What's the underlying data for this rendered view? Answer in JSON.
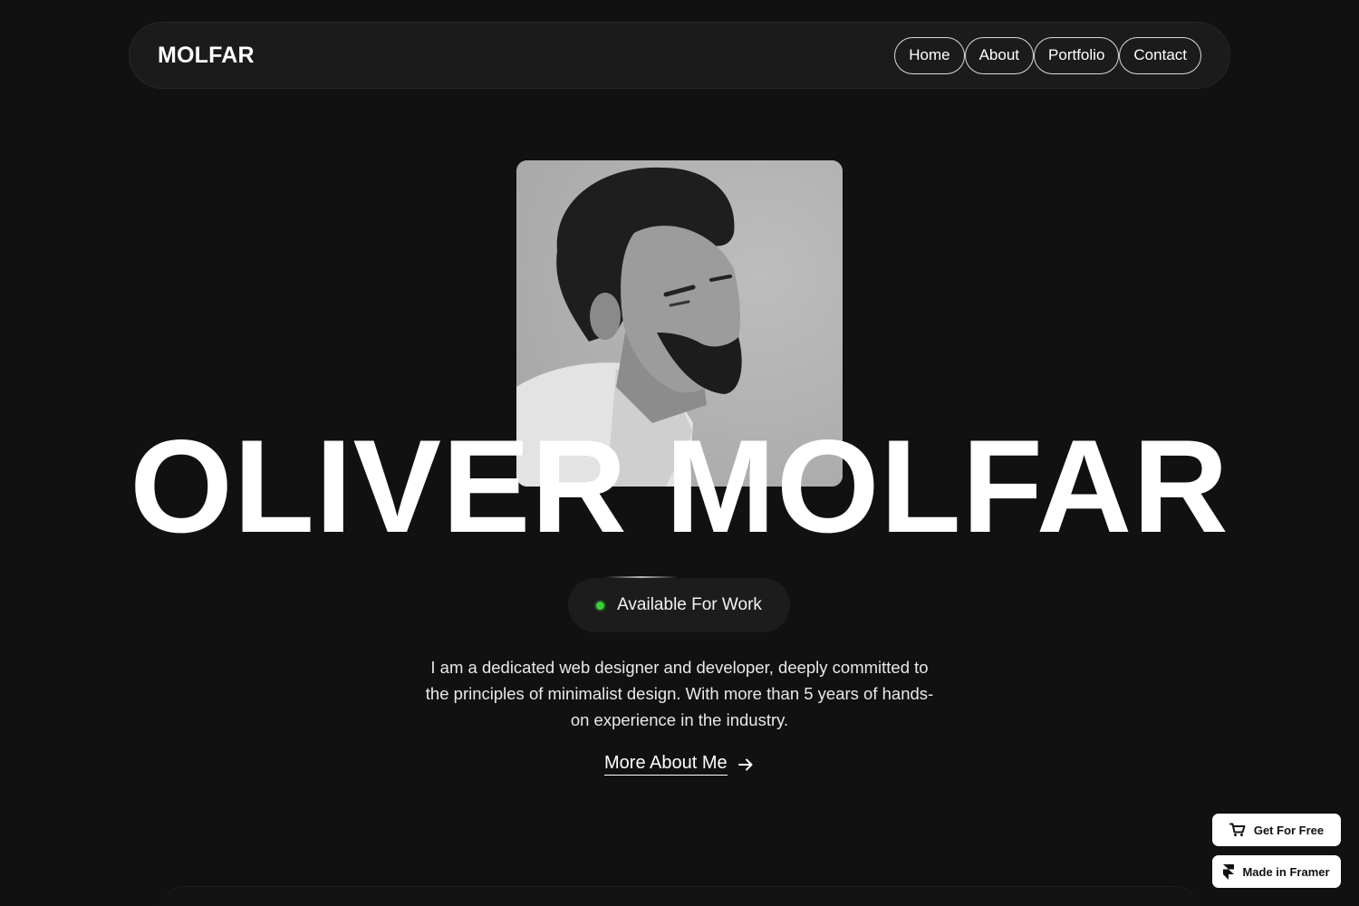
{
  "header": {
    "brand": "MOLFAR",
    "nav": [
      "Home",
      "About",
      "Portfolio",
      "Contact"
    ]
  },
  "hero": {
    "name": "OLIVER MOLFAR",
    "status": "Available For Work",
    "status_color": "#3ad13a",
    "intro": "I am a dedicated web designer and developer, deeply committed to the principles of minimalist design. With more than 5 years of hands-on experience in the industry.",
    "more_label": "More About Me"
  },
  "floating": {
    "get_label": "Get For Free",
    "framer_label": "Made in Framer"
  },
  "icons": {
    "more": "arrow-right-icon",
    "get": "cart-icon",
    "framer": "framer-logo-icon"
  }
}
